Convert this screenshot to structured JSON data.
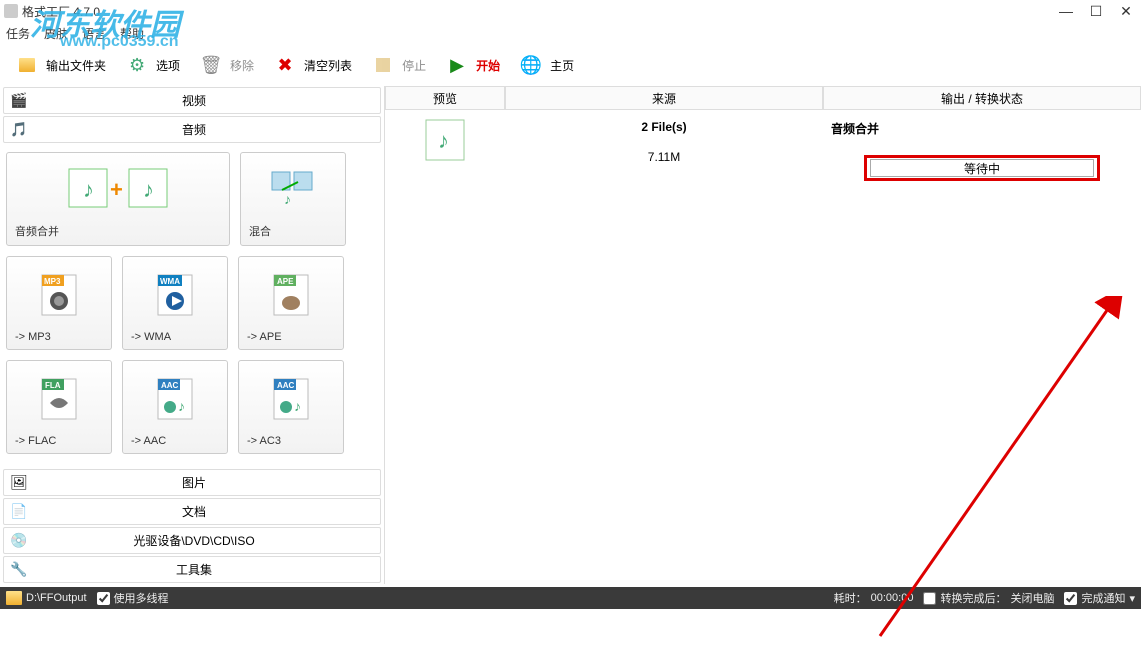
{
  "window": {
    "title": "格式工厂 4.7.0",
    "watermark": "河东软件园",
    "watermark_en": "www.pc0359.cn"
  },
  "menu": {
    "task": "任务",
    "skin": "皮肤",
    "language": "语言",
    "help": "帮助"
  },
  "toolbar": {
    "output": "输出文件夹",
    "options": "选项",
    "remove": "移除",
    "clear": "清空列表",
    "stop": "停止",
    "start": "开始",
    "home": "主页"
  },
  "categories": {
    "video": "视频",
    "audio": "音频",
    "picture": "图片",
    "document": "文档",
    "rom": "光驱设备\\DVD\\CD\\ISO",
    "toolset": "工具集"
  },
  "tiles": {
    "merge": "音频合并",
    "mix": "混合",
    "mp3": "-> MP3",
    "wma": "-> WMA",
    "ape": "-> APE",
    "flac": "-> FLAC",
    "aac": "-> AAC",
    "ac3": "-> AC3",
    "badges": {
      "mp3": "MP3",
      "wma": "WMA",
      "ape": "APE",
      "fla": "FLA",
      "aac": "AAC",
      "aac2": "AAC"
    }
  },
  "task_head": {
    "preview": "预览",
    "source": "来源",
    "output": "输出 / 转换状态"
  },
  "task": {
    "files": "2 File(s)",
    "size": "7.11M",
    "type": "音频合并",
    "status": "等待中"
  },
  "statusbar": {
    "output_path": "D:\\FFOutput",
    "multithread": "使用多线程",
    "elapsed_label": "耗时：",
    "elapsed_time": "00:00:00",
    "after_label": "转换完成后：",
    "after_value": "关闭电脑",
    "notify": "完成通知"
  }
}
